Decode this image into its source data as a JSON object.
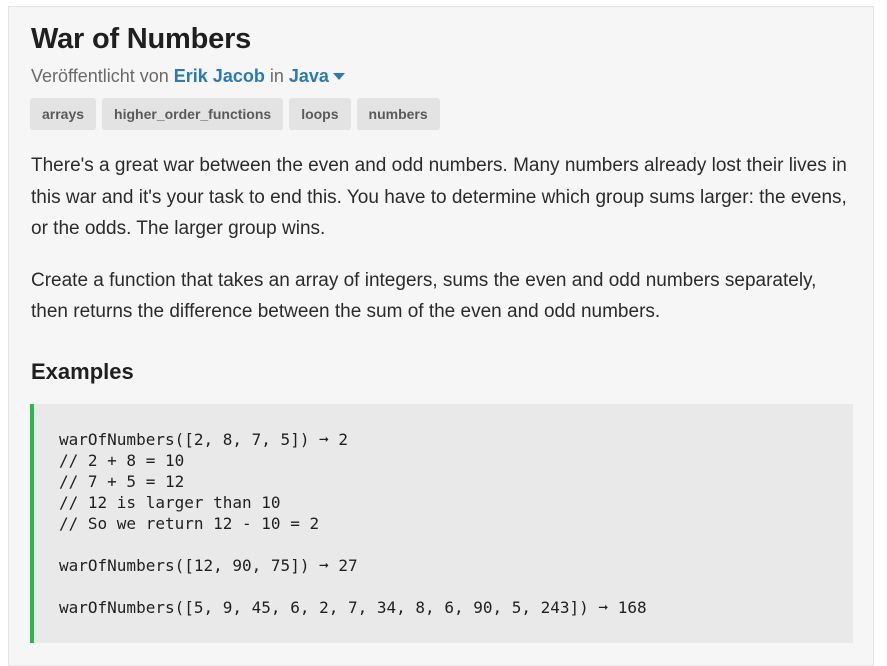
{
  "challenge": {
    "title": "War of Numbers",
    "published_prefix": "Veröffentlicht von",
    "author": "Erik Jacob",
    "in_word": "in",
    "language": "Java"
  },
  "tags": [
    "arrays",
    "higher_order_functions",
    "loops",
    "numbers"
  ],
  "description": {
    "paragraph_1": "There's a great war between the even and odd numbers. Many numbers already lost their lives in this war and it's your task to end this. You have to determine which group sums larger: the evens, or the odds. The larger group wins.",
    "paragraph_2": "Create a function that takes an array of integers, sums the even and odd numbers separately, then returns the difference between the sum of the even and odd numbers."
  },
  "examples": {
    "heading": "Examples",
    "code": "warOfNumbers([2, 8, 7, 5]) ➞ 2\n// 2 + 8 = 10\n// 7 + 5 = 12\n// 12 is larger than 10\n// So we return 12 - 10 = 2\n\nwarOfNumbers([12, 90, 75]) ➞ 27\n\nwarOfNumbers([5, 9, 45, 6, 2, 7, 34, 8, 6, 90, 5, 243]) ➞ 168"
  },
  "colors": {
    "link": "#2a7ab8",
    "code_border_accent": "#2db84d",
    "code_background": "#e9e9e9",
    "tag_background": "#e3e3e3"
  },
  "icons": {
    "language_dropdown": "caret-down-icon"
  }
}
